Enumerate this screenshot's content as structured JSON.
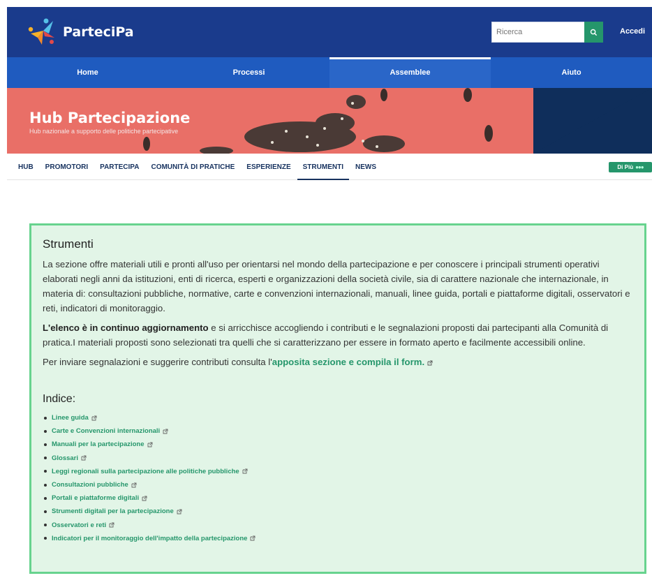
{
  "header": {
    "logo_text": "ParteciPa",
    "search_placeholder": "Ricerca",
    "login_label": "Accedi"
  },
  "mainnav": {
    "tabs": [
      {
        "label": "Home"
      },
      {
        "label": "Processi"
      },
      {
        "label": "Assemblee",
        "active": true
      },
      {
        "label": "Aiuto"
      }
    ]
  },
  "banner": {
    "title": "Hub Partecipazione",
    "subtitle": "Hub nazionale a supporto delle politiche partecipative"
  },
  "subnav": {
    "items": [
      {
        "label": "HUB"
      },
      {
        "label": "PROMOTORI"
      },
      {
        "label": "PARTECIPA"
      },
      {
        "label": "COMUNITÀ DI PRATICHE"
      },
      {
        "label": "ESPERIENZE"
      },
      {
        "label": "STRUMENTI",
        "active": true
      },
      {
        "label": "NEWS"
      }
    ],
    "more_label": "Di Più"
  },
  "content": {
    "title": "Strumenti",
    "para1": "La sezione offre materiali utili e pronti all'uso per orientarsi nel mondo della partecipazione e per conoscere i principali strumenti operativi elaborati negli anni da istituzioni, enti di ricerca, esperti e organizzazioni della società civile, sia di carattere nazionale che internazionale, in materia di: consultazioni pubbliche, normative, carte e convenzioni internazionali, manuali, linee guida, portali e piattaforme digitali, osservatori e reti, indicatori di monitoraggio.",
    "para2_bold": "L'elenco è in continuo aggiornamento",
    "para2_rest": " e si arricchisce accogliendo i contributi e le segnalazioni proposti dai partecipanti alla Comunità di pratica.I materiali proposti sono selezionati tra quelli che si caratterizzano per essere in formato aperto e facilmente accessibili online.",
    "para3_text": "Per inviare segnalazioni e suggerire contributi consulta l'",
    "para3_link": "apposita sezione e compila il form.",
    "index_title": "Indice:",
    "index_items": [
      "Linee guida",
      "Carte e Convenzioni internazionali",
      "Manuali per la partecipazione",
      "Glossari",
      "Leggi regionali sulla partecipazione alle politiche pubbliche",
      "Consultazioni pubbliche",
      "Portali e piattaforme digitali",
      "Strumenti digitali per la partecipazione",
      "Osservatori e reti",
      "Indicatori per il monitoraggio dell'impatto della partecipazione"
    ]
  },
  "colors": {
    "header_blue": "#1a3b8c",
    "nav_blue": "#1f5bbf",
    "accent_green": "#25966b",
    "panel_bg": "#e2f5e7",
    "panel_border": "#67d38e",
    "banner_red": "#e96f67"
  }
}
